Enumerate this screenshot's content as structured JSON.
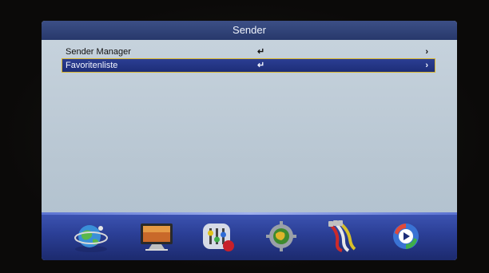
{
  "window": {
    "title": "Sender"
  },
  "menu": {
    "items": [
      {
        "label": "Sender Manager",
        "enter_glyph": "↵",
        "chevron": "›",
        "selected": false
      },
      {
        "label": "Favoritenliste",
        "enter_glyph": "↵",
        "chevron": "›",
        "selected": true
      }
    ]
  },
  "dock": {
    "icons": [
      "globe-satellite-icon",
      "tv-monitor-icon",
      "equalizer-settings-icon",
      "gear-globe-icon",
      "cable-plug-icon",
      "media-play-icon"
    ]
  },
  "colors": {
    "title_bar": "#2f4278",
    "selection": "#23348a",
    "selection_border": "#d8b630",
    "screen_bg": "#c0cdd8",
    "dock": "#2f44a0"
  }
}
